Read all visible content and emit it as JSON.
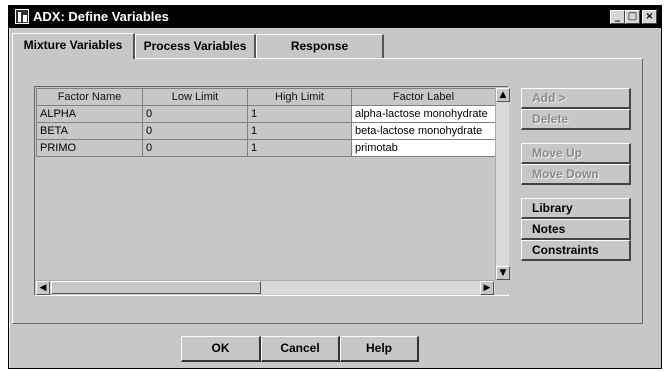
{
  "window": {
    "title": "ADX: Define Variables",
    "controls": {
      "minimize": "_",
      "maximize": "□",
      "close": "×"
    }
  },
  "tabs": [
    {
      "label": "Mixture Variables",
      "active": true
    },
    {
      "label": "Process Variables",
      "active": false
    },
    {
      "label": "Response",
      "active": false
    }
  ],
  "grid": {
    "columns": [
      "Factor Name",
      "Low Limit",
      "High Limit",
      "Factor Label"
    ],
    "rows": [
      {
        "name": "ALPHA",
        "low": "0",
        "high": "1",
        "label": "alpha-lactose monohydrate"
      },
      {
        "name": "BETA",
        "low": "0",
        "high": "1",
        "label": "beta-lactose monohydrate"
      },
      {
        "name": "PRIMO",
        "low": "0",
        "high": "1",
        "label": "primotab"
      }
    ],
    "scroll": {
      "up": "▲",
      "down": "▼",
      "left": "◀",
      "right": "▶"
    }
  },
  "side_buttons": [
    {
      "label": "Add >",
      "enabled": false
    },
    {
      "label": "Delete",
      "enabled": false
    },
    {
      "label": "Move Up",
      "enabled": false
    },
    {
      "label": "Move Down",
      "enabled": false
    },
    {
      "label": "Library",
      "enabled": true
    },
    {
      "label": "Notes",
      "enabled": true
    },
    {
      "label": "Constraints",
      "enabled": true
    }
  ],
  "bottom_buttons": {
    "ok": "OK",
    "cancel": "Cancel",
    "help": "Help"
  },
  "colors": {
    "face": "#c7c7c7",
    "titlebar": "#000000",
    "disabled_text": "#8a8a8a"
  }
}
